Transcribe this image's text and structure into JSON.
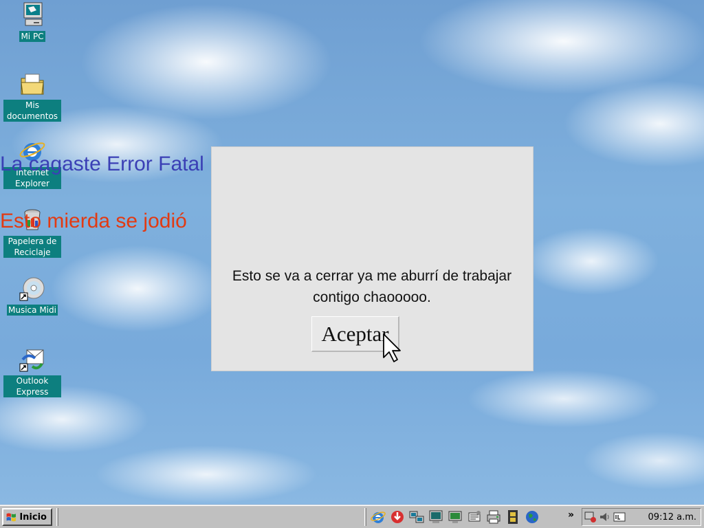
{
  "desktop": {
    "icons": [
      {
        "label": "Mi PC",
        "icon": "my-computer-icon"
      },
      {
        "label": "Mis documentos",
        "icon": "folder-documents-icon"
      },
      {
        "label": "Internet Explorer",
        "icon": "internet-explorer-icon"
      },
      {
        "label": "Papelera de Reciclaje",
        "icon": "recycle-bin-icon"
      },
      {
        "label": "Musica Midi",
        "icon": "cd-shortcut-icon"
      },
      {
        "label": "Outlook Express",
        "icon": "outlook-express-icon"
      }
    ]
  },
  "dialog": {
    "title": "La cagaste Error Fatal",
    "subtitle": "Esto mierda se jodió",
    "message": "Esto se va a cerrar ya me aburrí de trabajar contigo chaooooo.",
    "ok_label": "Aceptar",
    "title_color": "#3a3fb5",
    "subtitle_color": "#e23a12"
  },
  "taskbar": {
    "start_label": "Inicio",
    "quick_launch": [
      "internet-explorer-icon",
      "download-icon",
      "network-icon",
      "monitor-icon",
      "display-icon",
      "settings-icon",
      "printer-icon",
      "film-icon",
      "globe-icon"
    ],
    "overflow_label": "»",
    "tray_icons": [
      "system-icon",
      "volume-icon",
      "input-icon"
    ],
    "clock": "09:12 a.m."
  }
}
